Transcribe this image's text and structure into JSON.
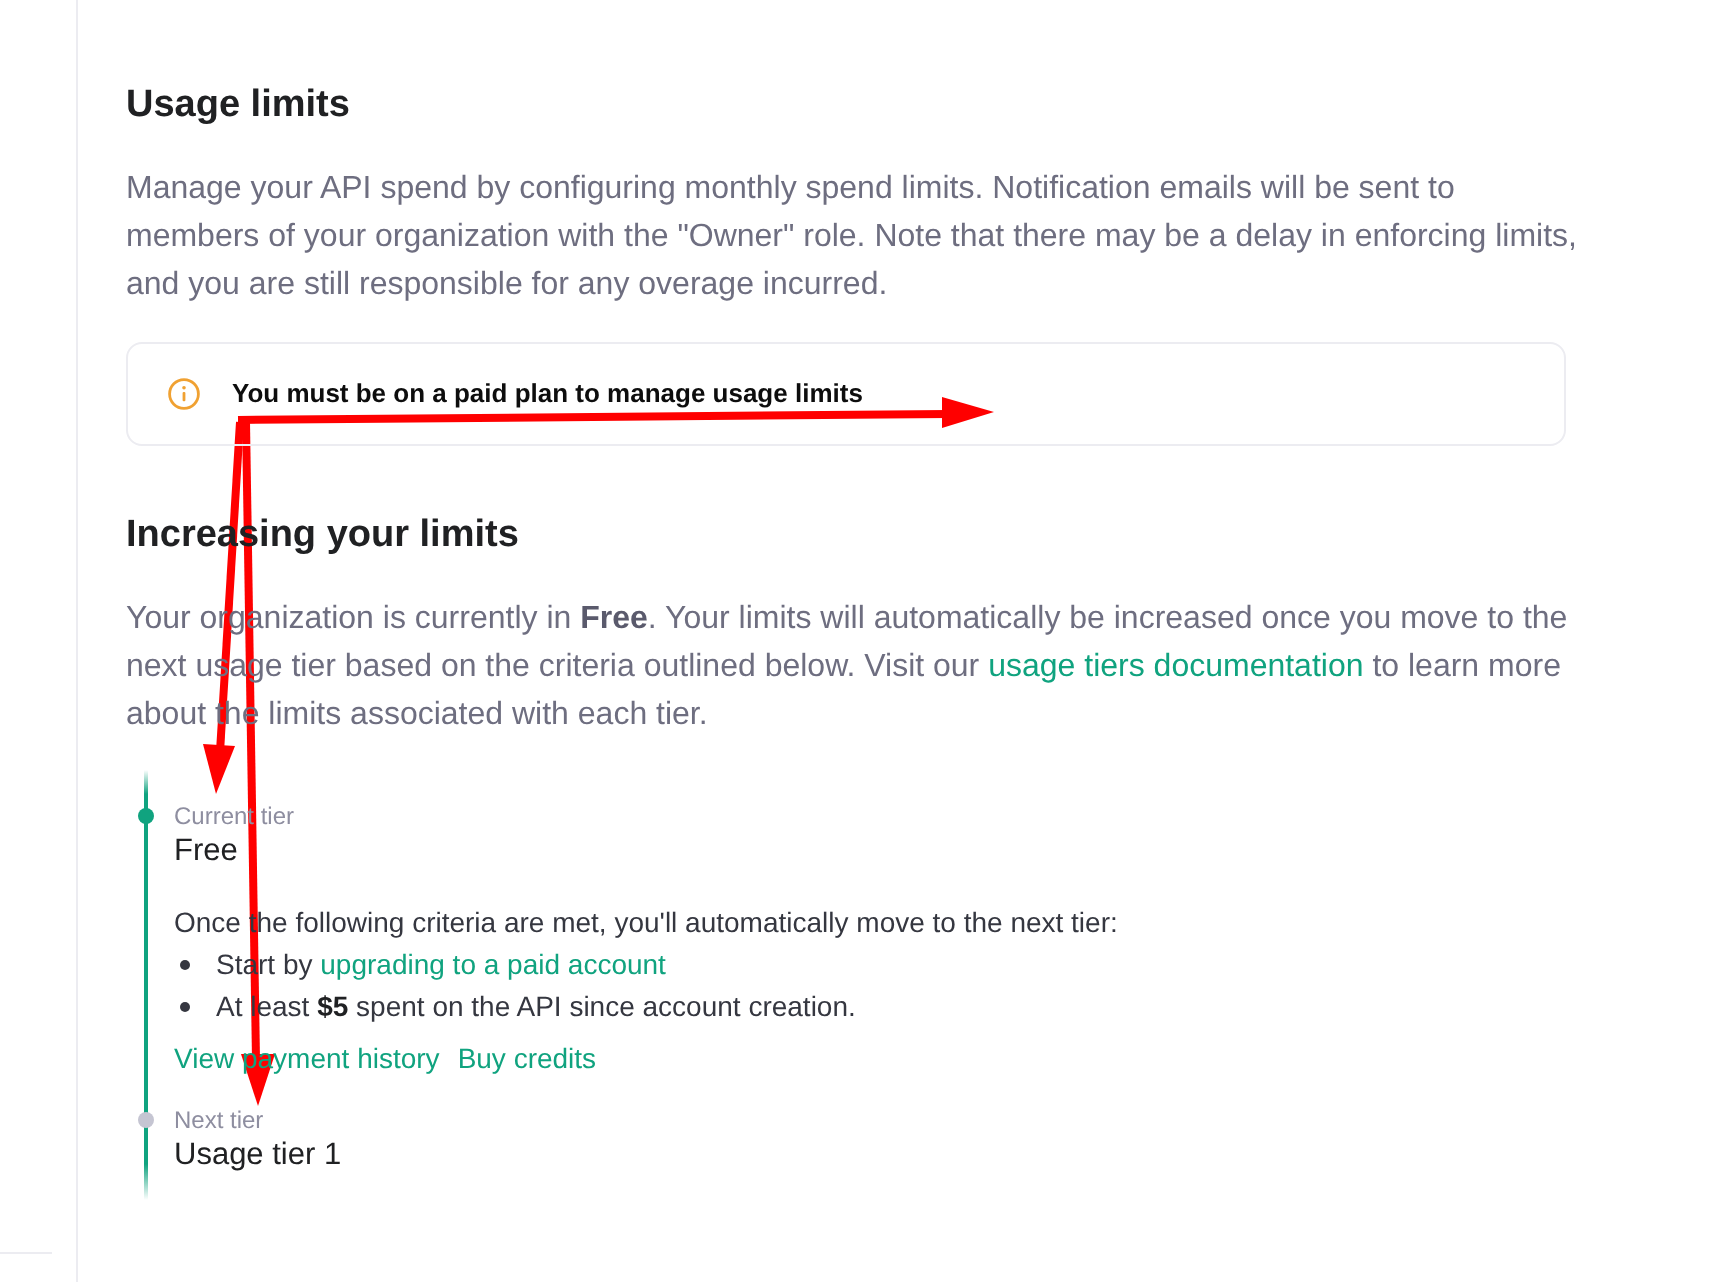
{
  "usage_limits": {
    "title": "Usage limits",
    "description": "Manage your API spend by configuring monthly spend limits. Notification emails will be sent to members of your organization with the \"Owner\" role. Note that there may be a delay in enforcing limits, and you are still responsible for any overage incurred.",
    "notice": "You must be on a paid plan to manage usage limits"
  },
  "increasing_limits": {
    "title": "Increasing your limits",
    "description": [
      {
        "kind": "text",
        "text": "Your organization is currently in **Free**. Your limits will automatically be increased once you move to the next usage tier based on the criteria outlined below. Visit our "
      },
      {
        "kind": "link",
        "text": "usage tiers documentation"
      },
      {
        "kind": "text",
        "text": " to learn more about the limits associated with each tier."
      }
    ]
  },
  "tiers": [
    {
      "label": "Current tier",
      "name": "Free",
      "current": true,
      "criteria_intro": "Once the following criteria are met, you'll automatically move to the next tier:",
      "criteria": [
        [
          {
            "kind": "text",
            "text": "Start by "
          },
          {
            "kind": "link",
            "text": "upgrading to a paid account"
          }
        ],
        [
          {
            "kind": "text",
            "text": "At least **$5** spent on the API since account creation."
          }
        ]
      ],
      "links": [
        "View payment history",
        "Buy credits"
      ]
    },
    {
      "label": "Next tier",
      "name": "Usage tier 1",
      "current": false
    }
  ]
}
